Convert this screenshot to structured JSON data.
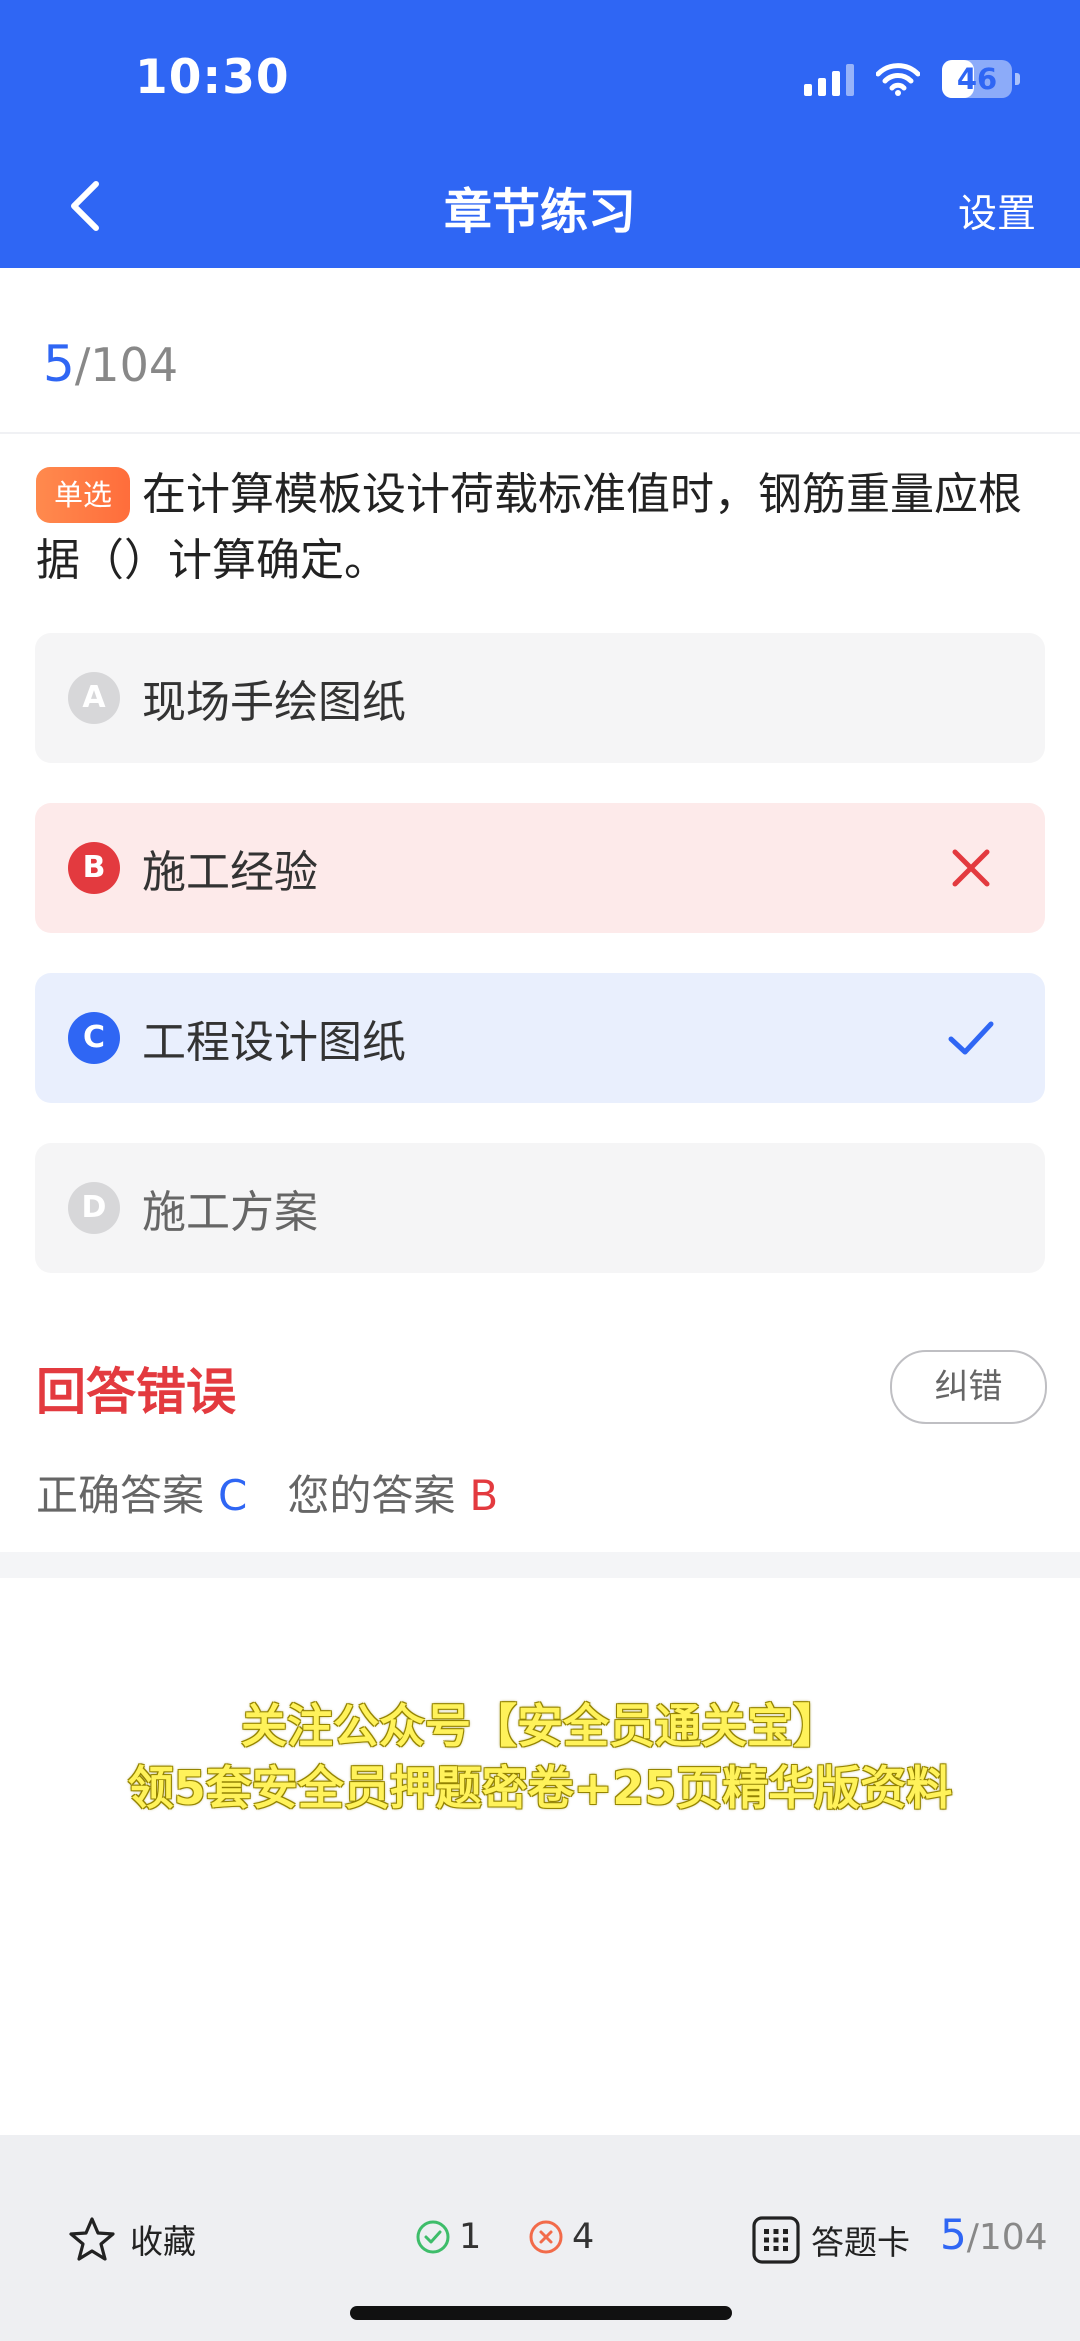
{
  "status_bar": {
    "time": "10:30",
    "battery": "46",
    "battery_level": 0.46
  },
  "header": {
    "title": "章节练习",
    "settings_label": "设置"
  },
  "progress": {
    "current": "5",
    "total": "/104"
  },
  "question": {
    "type_badge": "单选",
    "text": "在计算模板设计荷载标准值时，钢筋重量应根据（）计算确定。"
  },
  "options": [
    {
      "letter": "A",
      "text": "现场手绘图纸",
      "state": "normal"
    },
    {
      "letter": "B",
      "text": "施工经验",
      "state": "wrong"
    },
    {
      "letter": "C",
      "text": "工程设计图纸",
      "state": "correct"
    },
    {
      "letter": "D",
      "text": "施工方案",
      "state": "normal"
    }
  ],
  "result": {
    "status": "回答错误",
    "report_button": "纠错",
    "correct_label": "正确答案",
    "correct_value": "C",
    "your_label": "您的答案",
    "your_value": "B"
  },
  "promo": {
    "line1": "关注公众号【安全员通关宝】",
    "line2": "领5套安全员押题密卷+25页精华版资料"
  },
  "bottom_bar": {
    "favorite_label": "收藏",
    "correct_count": "1",
    "wrong_count": "4",
    "answer_card_label": "答题卡",
    "progress_current": "5",
    "progress_total": "/104"
  },
  "colors": {
    "primary": "#2f66f4",
    "error": "#e33a3f",
    "badge": "#ff7a45",
    "promo": "#fff25a"
  }
}
